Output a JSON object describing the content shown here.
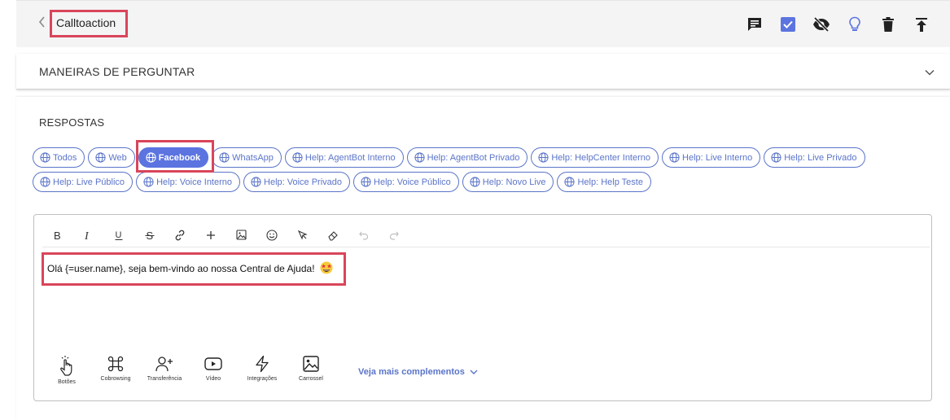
{
  "header": {
    "title": "Calltoaction",
    "icons": [
      "chat-icon",
      "checkbox-icon",
      "eye-off-icon",
      "lightbulb-icon",
      "trash-icon",
      "publish-icon"
    ]
  },
  "accordion": {
    "title": "MANEIRAS DE PERGUNTAR"
  },
  "responses": {
    "title": "RESPOSTAS",
    "channels_row1": [
      "Todos",
      "Web",
      "Facebook",
      "WhatsApp",
      "Help: AgentBot Interno",
      "Help: AgentBot Privado",
      "Help: HelpCenter Interno",
      "Help: Live Interno",
      "Help: Live Privado"
    ],
    "channels_row2": [
      "Help: Live Público",
      "Help: Voice Interno",
      "Help: Voice Privado",
      "Help: Voice Público",
      "Help: Novo Live",
      "Help: Help Teste"
    ],
    "active_channel": "Facebook"
  },
  "editor": {
    "message": "Olá {=user.name}, seja bem-vindo ao nossa Central de Ajuda!",
    "emoji": "star-struck-emoji",
    "toolbar": [
      "bold",
      "italic",
      "underline",
      "strikethrough",
      "link",
      "add",
      "image",
      "emoji",
      "pointer",
      "eraser",
      "undo",
      "redo"
    ],
    "complements": {
      "botoes": "Botões",
      "cobrowsing": "Cobrowsing",
      "transferencia": "Transferência",
      "video": "Vídeo",
      "integracoes": "Integrações",
      "carrossel": "Carrossel"
    },
    "more_label": "Veja mais complementos"
  },
  "colors": {
    "accent": "#5b74e0",
    "highlight": "#d9455a",
    "header_bg": "#f4f4f4"
  }
}
